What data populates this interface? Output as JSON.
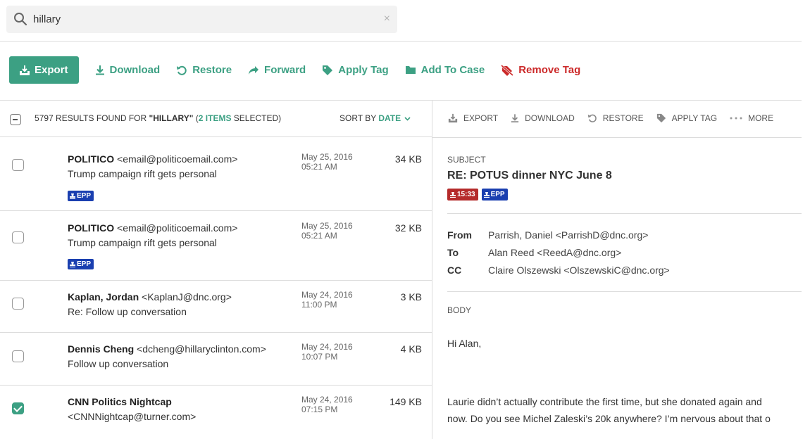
{
  "search": {
    "value": "hillary",
    "clear_glyph": "×",
    "icon": "search-icon"
  },
  "toolbar": {
    "export_label": "Export",
    "download_label": "Download",
    "restore_label": "Restore",
    "forward_label": "Forward",
    "apply_tag_label": "Apply Tag",
    "add_to_case_label": "Add To Case",
    "remove_tag_label": "Remove Tag"
  },
  "colors": {
    "accent": "#3ca083",
    "danger": "#cc2a2a",
    "epp_badge": "#1a3fb0",
    "time_badge": "#b52b2b"
  },
  "list_header": {
    "count": "5797",
    "results_prefix": " RESULTS FOUND FOR ",
    "query": "\"HILLARY\"",
    "open_paren": " (",
    "selected": "2 ITEMS",
    "selected_suffix": " SELECTED)",
    "sort_prefix": "SORT BY ",
    "sort_field": "DATE"
  },
  "messages": [
    {
      "sender_name": "POLITICO",
      "sender_email": " <email@politicoemail.com>",
      "subject": "Trump campaign rift gets personal",
      "date": "May 25, 2016",
      "time": "05:21 AM",
      "size": "34 KB",
      "badge": "EPP",
      "checked": false
    },
    {
      "sender_name": "POLITICO",
      "sender_email": " <email@politicoemail.com>",
      "subject": "Trump campaign rift gets personal",
      "date": "May 25, 2016",
      "time": "05:21 AM",
      "size": "32 KB",
      "badge": "EPP",
      "checked": false
    },
    {
      "sender_name": "Kaplan, Jordan",
      "sender_email": " <KaplanJ@dnc.org>",
      "subject": "Re: Follow up conversation",
      "date": "May 24, 2016",
      "time": "11:00 PM",
      "size": "3 KB",
      "checked": false
    },
    {
      "sender_name": "Dennis Cheng",
      "sender_email": " <dcheng@hillaryclinton.com>",
      "subject": "Follow up conversation",
      "date": "May 24, 2016",
      "time": "10:07 PM",
      "size": "4 KB",
      "checked": false
    },
    {
      "sender_name": "CNN Politics Nightcap",
      "sender_email": "<CNNNightcap@turner.com>",
      "subject": "",
      "date": "May 24, 2016",
      "time": "07:15 PM",
      "size": "149 KB",
      "checked": true
    }
  ],
  "detail": {
    "toolbar": {
      "export": "EXPORT",
      "download": "DOWNLOAD",
      "restore": "RESTORE",
      "apply_tag": "APPLY TAG",
      "more": "MORE"
    },
    "subject_label": "SUBJECT",
    "subject": "RE: POTUS dinner NYC June 8",
    "time_badge": "15:33",
    "epp_badge": "EPP",
    "from_label": "From",
    "from": "Parrish, Daniel <ParrishD@dnc.org>",
    "to_label": "To",
    "to": "Alan Reed <ReedA@dnc.org>",
    "cc_label": "CC",
    "cc": "Claire Olszewski <OlszewskiC@dnc.org>",
    "body_label": "BODY",
    "greeting": "Hi Alan,",
    "body_line1": "Laurie didn’t actually contribute the first time, but she donated again and",
    "body_line2": "now. Do you see Michel Zaleski’s 20k anywhere? I’m nervous about that o"
  }
}
